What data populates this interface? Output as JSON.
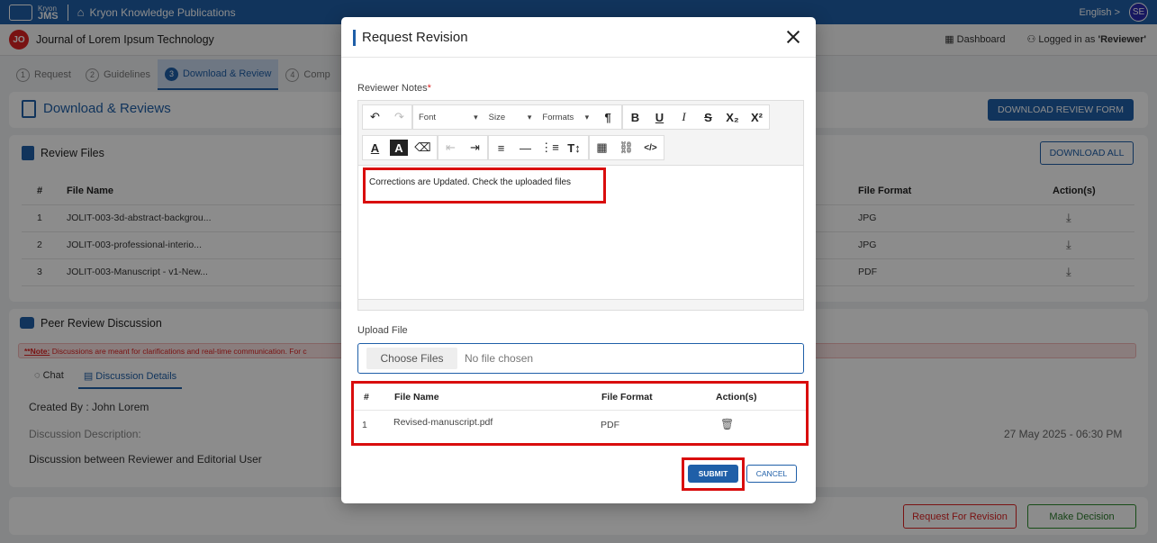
{
  "topbar": {
    "brand_small": "Kryon",
    "brand_name": "JMS",
    "publisher": "Kryon Knowledge Publications",
    "language": "English >",
    "user_initials": "SE"
  },
  "subbar": {
    "journal_initials": "JO",
    "journal_title": "Journal of Lorem Ipsum Technology",
    "dashboard": "Dashboard",
    "logged_in_prefix": "Logged in as ",
    "logged_in_role": "'Reviewer'"
  },
  "tabs": [
    {
      "num": "1",
      "label": "Request"
    },
    {
      "num": "2",
      "label": "Guidelines"
    },
    {
      "num": "3",
      "label": "Download & Review"
    },
    {
      "num": "4",
      "label": "Comp"
    }
  ],
  "download_section": {
    "title": "Download & Reviews",
    "button": "DOWNLOAD REVIEW FORM"
  },
  "review_files": {
    "title": "Review Files",
    "download_all": "DOWNLOAD ALL",
    "columns": [
      "#",
      "File Name",
      "File Format",
      "Action(s)"
    ],
    "rows": [
      {
        "num": "1",
        "name": "JOLIT-003-3d-abstract-backgrou...",
        "format": "JPG"
      },
      {
        "num": "2",
        "name": "JOLIT-003-professional-interio...",
        "format": "JPG"
      },
      {
        "num": "3",
        "name": "JOLIT-003-Manuscript - v1-New...",
        "format": "PDF"
      }
    ]
  },
  "peer_review": {
    "title": "Peer Review Discussion",
    "note_label": "**Note:",
    "note_text": " Discussions are meant for clarifications and real-time communication. For c",
    "tab_chat": "Chat",
    "tab_details": "Discussion Details",
    "created_by": "Created By : John Lorem",
    "description_label": "Discussion Description:",
    "date": "27 May 2025 - 06:30 PM",
    "description": "Discussion between Reviewer and Editorial User"
  },
  "bottom": {
    "request_revision": "Request For Revision",
    "make_decision": "Make Decision"
  },
  "modal": {
    "title": "Request Revision",
    "notes_label": "Reviewer Notes",
    "required_mark": "*",
    "toolbar": {
      "font": "Font",
      "size": "Size",
      "formats": "Formats"
    },
    "notes_text": "Corrections are  Updated. Check the uploaded files",
    "upload_label": "Upload File",
    "choose_files": "Choose Files",
    "no_file": "No file chosen",
    "upload_columns": [
      "#",
      "File Name",
      "File Format",
      "Action(s)"
    ],
    "uploaded": [
      {
        "num": "1",
        "name": "Revised-manuscript.pdf",
        "format": "PDF"
      }
    ],
    "submit": "SUBMIT",
    "cancel": "CANCEL"
  }
}
